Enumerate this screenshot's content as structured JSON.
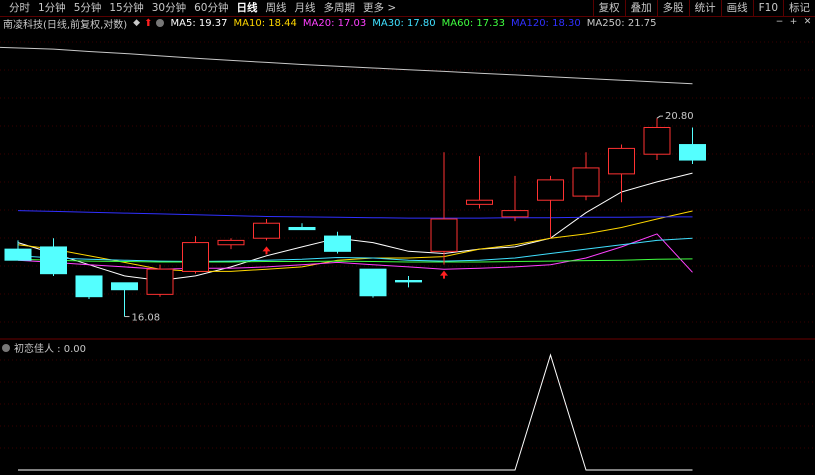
{
  "toolbar": {
    "periods": [
      "分时",
      "1分钟",
      "5分钟",
      "15分钟",
      "30分钟",
      "60分钟",
      "日线",
      "周线",
      "月线",
      "多周期",
      "更多 >"
    ],
    "active_period": "日线",
    "right_buttons": [
      "复权",
      "叠加",
      "多股",
      "统计",
      "画线",
      "F10",
      "标记"
    ]
  },
  "info": {
    "stock_name": "南凌科技(日线,前复权,对数)",
    "ma": [
      {
        "label": "MA5: 19.37",
        "color": "#ffffff"
      },
      {
        "label": "MA10: 18.44",
        "color": "#ffd700"
      },
      {
        "label": "MA20: 17.03",
        "color": "#ff40ff"
      },
      {
        "label": "MA30: 17.80",
        "color": "#40e0ff"
      },
      {
        "label": "MA60: 17.33",
        "color": "#40ff40"
      },
      {
        "label": "MA120: 18.30",
        "color": "#3030ff"
      },
      {
        "label": "MA250: 21.75",
        "color": "#c8c8c8"
      }
    ]
  },
  "indicator": {
    "label": "初恋佳人 : 0.00"
  },
  "chart_data": {
    "type": "candlestick",
    "scale": "log",
    "annotations": {
      "high": "20.80",
      "low": "16.08"
    },
    "candles": [
      {
        "o": 17.55,
        "h": 17.75,
        "l": 17.3,
        "c": 17.3
      },
      {
        "o": 17.6,
        "h": 17.8,
        "l": 16.95,
        "c": 17.0
      },
      {
        "o": 16.95,
        "h": 16.95,
        "l": 16.45,
        "c": 16.5
      },
      {
        "o": 16.8,
        "h": 16.8,
        "l": 16.08,
        "c": 16.65
      },
      {
        "o": 16.55,
        "h": 17.2,
        "l": 16.5,
        "c": 17.1
      },
      {
        "o": 17.05,
        "h": 17.85,
        "l": 17.0,
        "c": 17.7
      },
      {
        "o": 17.65,
        "h": 17.8,
        "l": 17.55,
        "c": 17.75
      },
      {
        "o": 17.8,
        "h": 18.25,
        "l": 17.75,
        "c": 18.15
      },
      {
        "o": 18.05,
        "h": 18.15,
        "l": 18.0,
        "c": 18.0
      },
      {
        "o": 17.85,
        "h": 17.95,
        "l": 17.45,
        "c": 17.5
      },
      {
        "o": 17.1,
        "h": 17.1,
        "l": 16.48,
        "c": 16.52
      },
      {
        "o": 16.85,
        "h": 16.95,
        "l": 16.7,
        "c": 16.82
      },
      {
        "o": 17.5,
        "h": 19.9,
        "l": 17.2,
        "c": 18.25
      },
      {
        "o": 18.6,
        "h": 19.8,
        "l": 18.5,
        "c": 18.7
      },
      {
        "o": 18.3,
        "h": 19.3,
        "l": 18.2,
        "c": 18.45
      },
      {
        "o": 18.7,
        "h": 19.3,
        "l": 17.8,
        "c": 19.2
      },
      {
        "o": 18.8,
        "h": 19.9,
        "l": 18.7,
        "c": 19.5
      },
      {
        "o": 19.35,
        "h": 20.1,
        "l": 18.65,
        "c": 20.0
      },
      {
        "o": 19.85,
        "h": 20.8,
        "l": 19.7,
        "c": 20.55
      },
      {
        "o": 20.1,
        "h": 20.55,
        "l": 19.6,
        "c": 19.7
      }
    ],
    "ma_lines": {
      "MA5": [
        17.7,
        17.45,
        17.2,
        16.95,
        16.85,
        16.95,
        17.15,
        17.4,
        17.6,
        17.8,
        17.7,
        17.5,
        17.45,
        17.55,
        17.6,
        17.8,
        18.4,
        18.9,
        19.15,
        19.37
      ],
      "MA10": [
        17.65,
        17.55,
        17.4,
        17.25,
        17.1,
        17.05,
        17.05,
        17.1,
        17.15,
        17.3,
        17.35,
        17.35,
        17.38,
        17.55,
        17.65,
        17.8,
        17.9,
        18.05,
        18.25,
        18.44
      ],
      "MA20": [
        17.3,
        17.25,
        17.2,
        17.15,
        17.1,
        17.12,
        17.12,
        17.15,
        17.2,
        17.25,
        17.2,
        17.15,
        17.1,
        17.12,
        17.15,
        17.2,
        17.35,
        17.6,
        17.9,
        17.03
      ],
      "MA30": [
        17.4,
        17.35,
        17.32,
        17.3,
        17.28,
        17.27,
        17.28,
        17.3,
        17.32,
        17.36,
        17.35,
        17.3,
        17.28,
        17.3,
        17.35,
        17.45,
        17.55,
        17.65,
        17.75,
        17.8
      ],
      "MA60": [
        17.32,
        17.3,
        17.28,
        17.27,
        17.26,
        17.26,
        17.26,
        17.27,
        17.27,
        17.28,
        17.27,
        17.26,
        17.26,
        17.26,
        17.27,
        17.28,
        17.29,
        17.3,
        17.32,
        17.33
      ],
      "MA120": [
        18.45,
        18.43,
        18.41,
        18.39,
        18.37,
        18.35,
        18.33,
        18.31,
        18.3,
        18.29,
        18.28,
        18.27,
        18.27,
        18.27,
        18.28,
        18.28,
        18.29,
        18.29,
        18.3,
        18.3
      ],
      "MA250": [
        22.8,
        22.75,
        22.68,
        22.62,
        22.55,
        22.48,
        22.42,
        22.36,
        22.3,
        22.25,
        22.2,
        22.15,
        22.1,
        22.05,
        22.0,
        21.95,
        21.9,
        21.85,
        21.8,
        21.75
      ]
    },
    "signals_up_index": [
      7,
      12
    ],
    "indicator_values": [
      0,
      0,
      0,
      0,
      0,
      0,
      0,
      0,
      0,
      0,
      0,
      0,
      0,
      0,
      0,
      1,
      0,
      0,
      0,
      0
    ]
  }
}
